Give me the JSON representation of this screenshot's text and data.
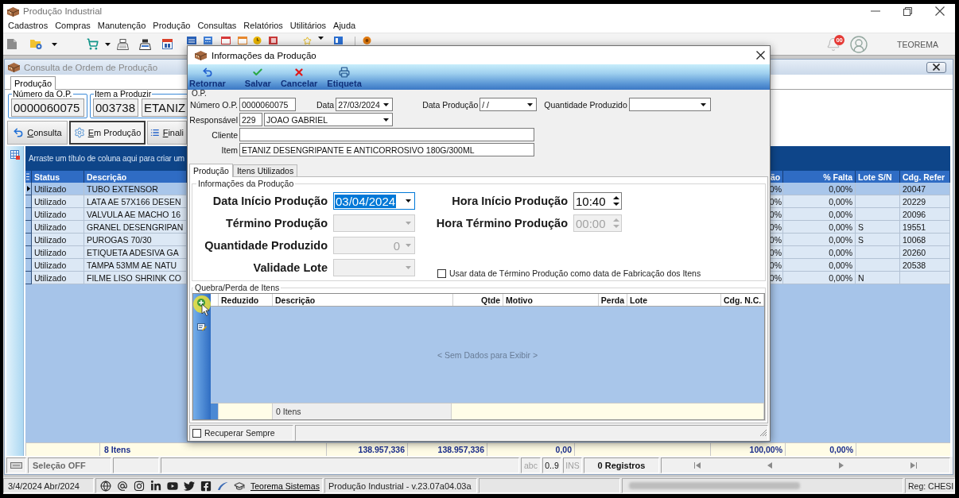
{
  "window": {
    "title": "Produção Industrial"
  },
  "menu": [
    "Cadastros",
    "Compras",
    "Manutenção",
    "Produção",
    "Consultas",
    "Relatórios",
    "Utilitários",
    "Ajuda"
  ],
  "toolbar": {
    "notification_badge": "00",
    "user_name": "TEOREMA"
  },
  "consulta": {
    "title": "Consulta de Ordem de Produção",
    "tabs": [
      {
        "label": "Produção",
        "selected": true
      }
    ],
    "numero_op": {
      "label": "Número da O.P.",
      "value": "0000060075"
    },
    "item_a_produzir": {
      "label": "Item a Produzir",
      "code": "003738",
      "name": "ETANIZ"
    },
    "buttons": [
      {
        "label": "Consulta",
        "kind": "return",
        "selected": false
      },
      {
        "label": "Em Produção",
        "kind": "gear",
        "selected": true
      },
      {
        "label": "Finali",
        "kind": "list",
        "selected": false
      }
    ],
    "grid": {
      "group_hint": "Arraste um título de coluna aqui para criar um",
      "columns": [
        "Status",
        "Descrição",
        "ão",
        "% Falta",
        "Lote S/N",
        "Cdg. Refer"
      ],
      "rows": [
        {
          "selected": true,
          "status": "Utilizado",
          "descricao": "TUBO EXTENSOR",
          "column_3": "0%",
          "falta": "0,00%",
          "ref": "20047"
        },
        {
          "selected": false,
          "status": "Utilizado",
          "descricao": "LATA AE 57X166 DESEN",
          "column_3": "0%",
          "falta": "0,00%",
          "ref": "20229"
        },
        {
          "selected": false,
          "status": "Utilizado",
          "descricao": "VALVULA AE MACHO 16",
          "column_3": "0%",
          "falta": "0,00%",
          "ref": "20096"
        },
        {
          "selected": false,
          "status": "Utilizado",
          "descricao": "GRANEL DESENGRIPAN",
          "column_3": "0%",
          "falta": "0,00%",
          "lote": "S",
          "ref": "19551"
        },
        {
          "selected": false,
          "status": "Utilizado",
          "descricao": "PUROGAS 70/30",
          "column_3": "0%",
          "falta": "0,00%",
          "lote": "S",
          "ref": "10068"
        },
        {
          "selected": false,
          "status": "Utilizado",
          "descricao": "ETIQUETA ADESIVA GA",
          "column_3": "0%",
          "falta": "0,00%",
          "ref": "20260"
        },
        {
          "selected": false,
          "status": "Utilizado",
          "descricao": "TAMPA 53MM AE NATU",
          "column_3": "0%",
          "falta": "0,00%",
          "ref": "20538"
        },
        {
          "selected": false,
          "status": "Utilizado",
          "descricao": "FILME LISO SHRINK CO",
          "column_3": "0%",
          "falta": "0,00%",
          "lote": "N"
        }
      ],
      "footer": [
        "8 Itens",
        "138.957,336",
        "138.957,336",
        "0,00",
        "100,00%",
        "0,00%"
      ]
    },
    "status_bar": {
      "selection": "Seleção OFF",
      "indicators": [
        {
          "label": "abc",
          "on": false
        },
        {
          "label": "0..9",
          "on": true
        },
        {
          "label": "INS",
          "on": false
        }
      ],
      "records": "0 Registros"
    }
  },
  "dialog": {
    "title": "Informações da Produção",
    "toolbar": [
      {
        "label": "Retornar",
        "kind": "return"
      },
      {
        "label": "Salvar",
        "kind": "save"
      },
      {
        "label": "Cancelar",
        "kind": "cancel"
      },
      {
        "label": "Etiqueta",
        "kind": "print"
      }
    ],
    "op": {
      "group_label": "O.P.",
      "numero_op": {
        "label": "Número O.P.",
        "value": "0000060075"
      },
      "data": {
        "label": "Data",
        "value": "27/03/2024"
      },
      "data_producao": {
        "label": "Data Produção",
        "value": "/ /"
      },
      "quantidade_produzido": {
        "label": "Quantidade Produzido"
      },
      "responsavel": {
        "label": "Responsável",
        "code": "229",
        "name": "JOAO GABRIEL"
      },
      "cliente": {
        "label": "Cliente"
      },
      "item": {
        "label": "Item",
        "value": "ETANIZ DESENGRIPANTE E ANTICORROSIVO 180G/300ML"
      }
    },
    "tabs": [
      {
        "label": "Produção",
        "selected": true
      },
      {
        "label": "Itens Utilizados",
        "selected": false
      }
    ],
    "producao": {
      "title": "Informações da Produção",
      "fields": [
        {
          "label": "Data Início Produção",
          "kind": "date",
          "value": "03/04/2024",
          "disabled": false,
          "focused": true
        },
        {
          "label": "Término Produção",
          "kind": "date",
          "disabled": true,
          "focused": false
        },
        {
          "label": "Quantidade Produzido",
          "kind": "number",
          "value": "0",
          "disabled": true,
          "focused": false
        },
        {
          "label": "Validade Lote",
          "kind": "date",
          "disabled": true,
          "focused": false
        }
      ],
      "time_fields": [
        {
          "label": "Hora Início Produção",
          "value": "10:40",
          "disabled": false
        },
        {
          "label": "Hora Término Produção",
          "value": "00:00",
          "disabled": true
        }
      ],
      "option": {
        "label": "Usar data de Término Produção como data de Fabricação dos Itens",
        "checked": false
      }
    },
    "perdas": {
      "title": "Quebra/Perda de Itens",
      "columns": [
        "Reduzido",
        "Descrição",
        "Qtde",
        "Motivo",
        "Perda",
        "Lote",
        "Cdg. N.C."
      ],
      "empty_text": "< Sem Dados para Exibir >",
      "footer": "0 Itens"
    },
    "recuperar": {
      "label": "Recuperar Sempre",
      "checked": false
    }
  },
  "taskbar": {
    "date": "3/4/2024 Abr/2024",
    "link": "Teorema Sistemas",
    "version": "Produção Industrial - v.23.07a04.03a",
    "registration": "Reg: CHESI"
  }
}
